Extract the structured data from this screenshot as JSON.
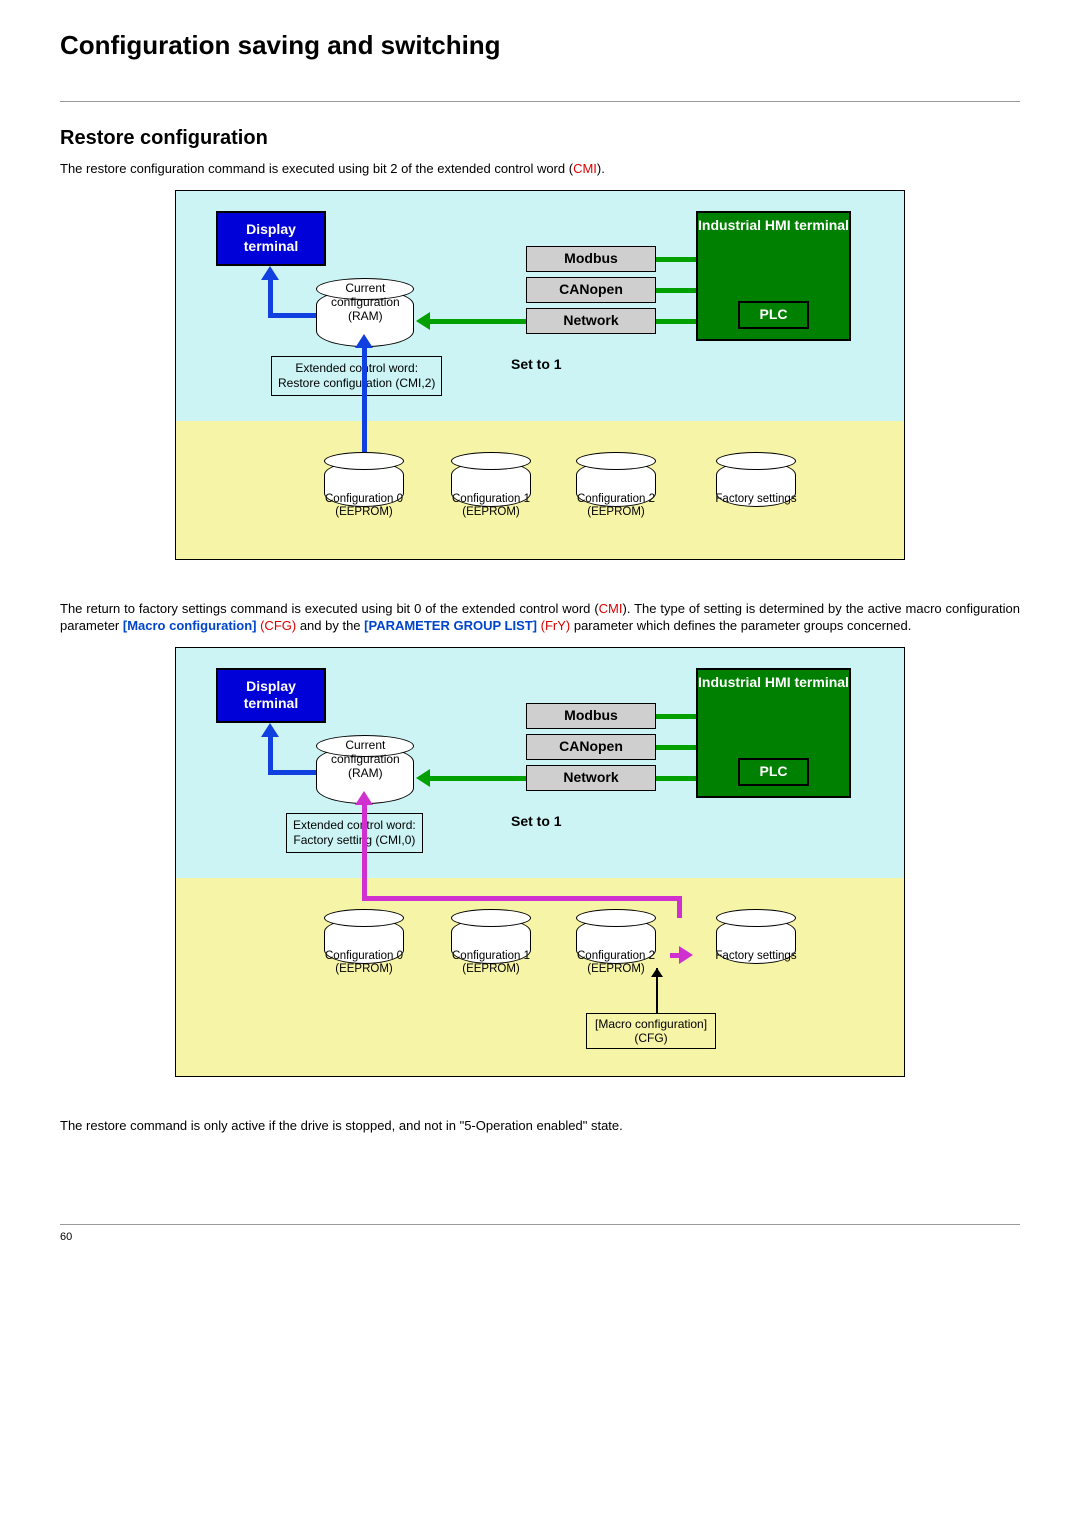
{
  "heading": "Configuration saving and switching",
  "subheading": "Restore configuration",
  "intro": {
    "pre": "The restore configuration command is executed using bit 2 of the extended control word (",
    "cmi": "CMI",
    "post": ")."
  },
  "para2": {
    "t1": "The return to factory settings command is executed using bit 0 of the extended control word (",
    "cmi": "CMI",
    "t2": "). The type of setting is determined by the active macro configuration parameter ",
    "macro": "[Macro configuration]",
    "cfg": " (CFG)",
    "t3": " and by the ",
    "pgl": "[PARAMETER GROUP LIST]",
    "fry": " (FrY)",
    "t4": " parameter which defines the parameter groups concerned."
  },
  "para3": "The restore command is only active if the drive is stopped, and not in \"5-Operation enabled\" state.",
  "labels": {
    "display_terminal": "Display terminal",
    "industrial_hmi": "Industrial HMI terminal",
    "plc": "PLC",
    "modbus": "Modbus",
    "canopen": "CANopen",
    "network": "Network",
    "set_to_1": "Set to 1",
    "cur_cfg_l1": "Current",
    "cur_cfg_l2": "configuration",
    "cur_cfg_l3": "(RAM)",
    "ecw1_l1": "Extended control word:",
    "ecw1_l2": "Restore configuration (CMI,2)",
    "ecw2_l1": "Extended control word:",
    "ecw2_l2": "Factory setting (CMI,0)",
    "cfg0": "Configuration 0",
    "cfg1": "Configuration 1",
    "cfg2": "Configuration 2",
    "eeprom": "(EEPROM)",
    "factory": "Factory settings",
    "macro_l1": "[Macro configuration]",
    "macro_l2": "(CFG)"
  },
  "page_number": "60"
}
